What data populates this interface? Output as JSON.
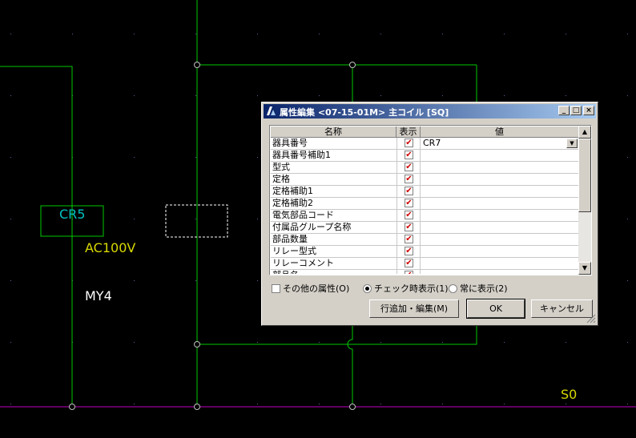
{
  "cad": {
    "labels": {
      "cr5": "CR5",
      "ac100v": "AC100V",
      "my4": "MY4",
      "s0": "S0"
    },
    "colors": {
      "background": "#000000",
      "wire": "#00c800",
      "busbar": "#c000c0",
      "symbol_text": "#00c0c0",
      "attribute_text": "#d8d800",
      "white_text": "#ffffff",
      "grid_dot": "#6060a0"
    }
  },
  "dialog": {
    "title": "属性編集 <07-15-01M> 主コイル [SQ]",
    "caption_buttons": {
      "minimize": "_",
      "maximize": "□",
      "close": "×"
    },
    "table": {
      "headers": {
        "name": "名称",
        "display": "表示",
        "value": "値"
      },
      "rows": [
        {
          "name": "器具番号",
          "checked": "✔",
          "value": "CR7",
          "dropdown": "▼"
        },
        {
          "name": "器具番号補助1",
          "checked": "✔",
          "value": ""
        },
        {
          "name": "型式",
          "checked": "✔",
          "value": ""
        },
        {
          "name": "定格",
          "checked": "✔",
          "value": ""
        },
        {
          "name": "定格補助1",
          "checked": "✔",
          "value": ""
        },
        {
          "name": "定格補助2",
          "checked": "✔",
          "value": ""
        },
        {
          "name": "電気部品コード",
          "checked": "✔",
          "value": ""
        },
        {
          "name": "付属品グループ名称",
          "checked": "✔",
          "value": ""
        },
        {
          "name": "部品数量",
          "checked": "✔",
          "value": ""
        },
        {
          "name": "リレー型式",
          "checked": "✔",
          "value": ""
        },
        {
          "name": "リレーコメント",
          "checked": "✔",
          "value": ""
        },
        {
          "name": "部品名",
          "checked": "✔",
          "value": ""
        }
      ],
      "scroll_up": "▲",
      "scroll_down": "▼"
    },
    "options": {
      "other_attributes": "その他の属性(O)",
      "show_when_checked": "チェック時表示(1)",
      "always_show": "常に表示(2)"
    },
    "buttons": {
      "add_edit_row": "行追加・編集(M)",
      "ok": "OK",
      "cancel": "キャンセル"
    }
  }
}
